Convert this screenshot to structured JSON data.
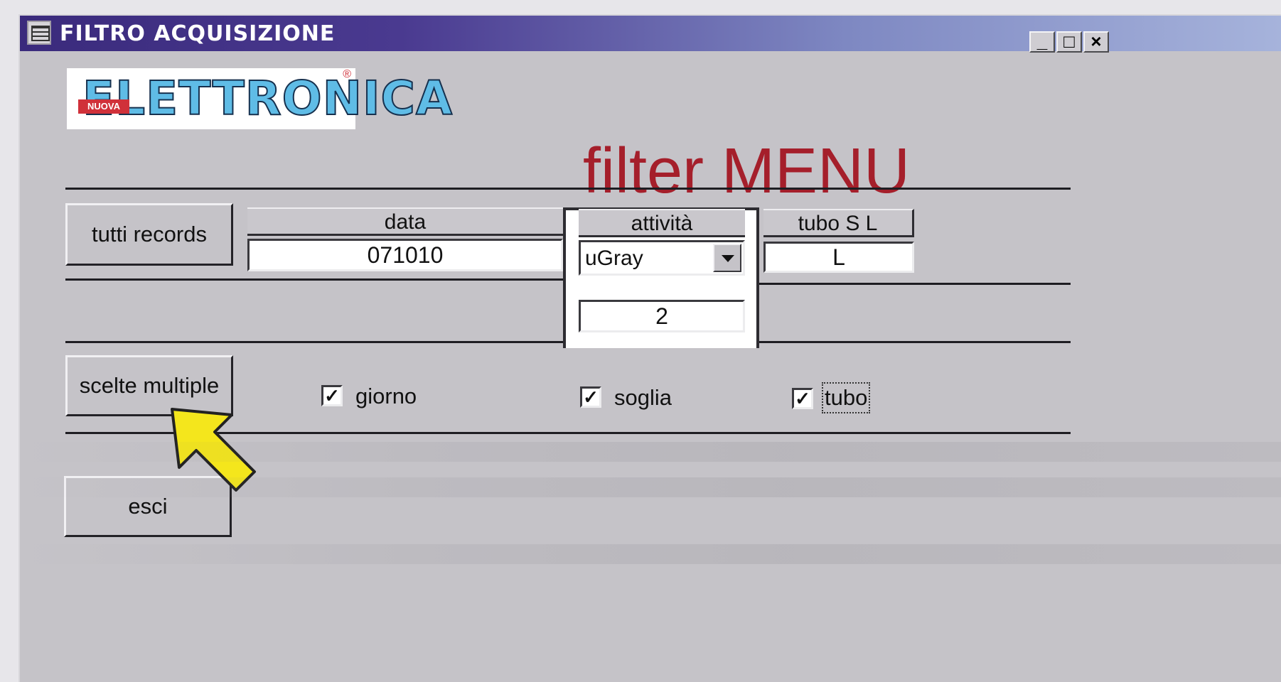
{
  "window": {
    "title": "FILTRO ACQUISIZIONE",
    "minimize_glyph": "_",
    "maximize_glyph": "□",
    "close_glyph": "×"
  },
  "logo": {
    "text": "ELETTRONICA",
    "badge": "NUOVA",
    "mark": "®"
  },
  "heading": "filter MENU",
  "buttons": {
    "all_records": "tutti records",
    "multiple_choices": "scelte multiple",
    "exit": "esci"
  },
  "columns": {
    "data": {
      "header": "data",
      "value": "071010"
    },
    "activity": {
      "header": "attività",
      "selected": "uGray",
      "threshold": "2"
    },
    "tube": {
      "header": "tubo S L",
      "value": "L"
    }
  },
  "checkboxes": [
    {
      "label": "giorno",
      "checked": true,
      "mark": "✓"
    },
    {
      "label": "soglia",
      "checked": true,
      "mark": "✓"
    },
    {
      "label": "tubo",
      "checked": true,
      "mark": "✓"
    }
  ],
  "colors": {
    "heading": "#a51f2b",
    "titlebar_start": "#3a2a7c",
    "titlebar_end": "#a7b4dc",
    "pointer": "#f4e61c"
  },
  "icons": [
    "app-icon",
    "pointer-arrow-icon",
    "dropdown-arrow-icon"
  ]
}
